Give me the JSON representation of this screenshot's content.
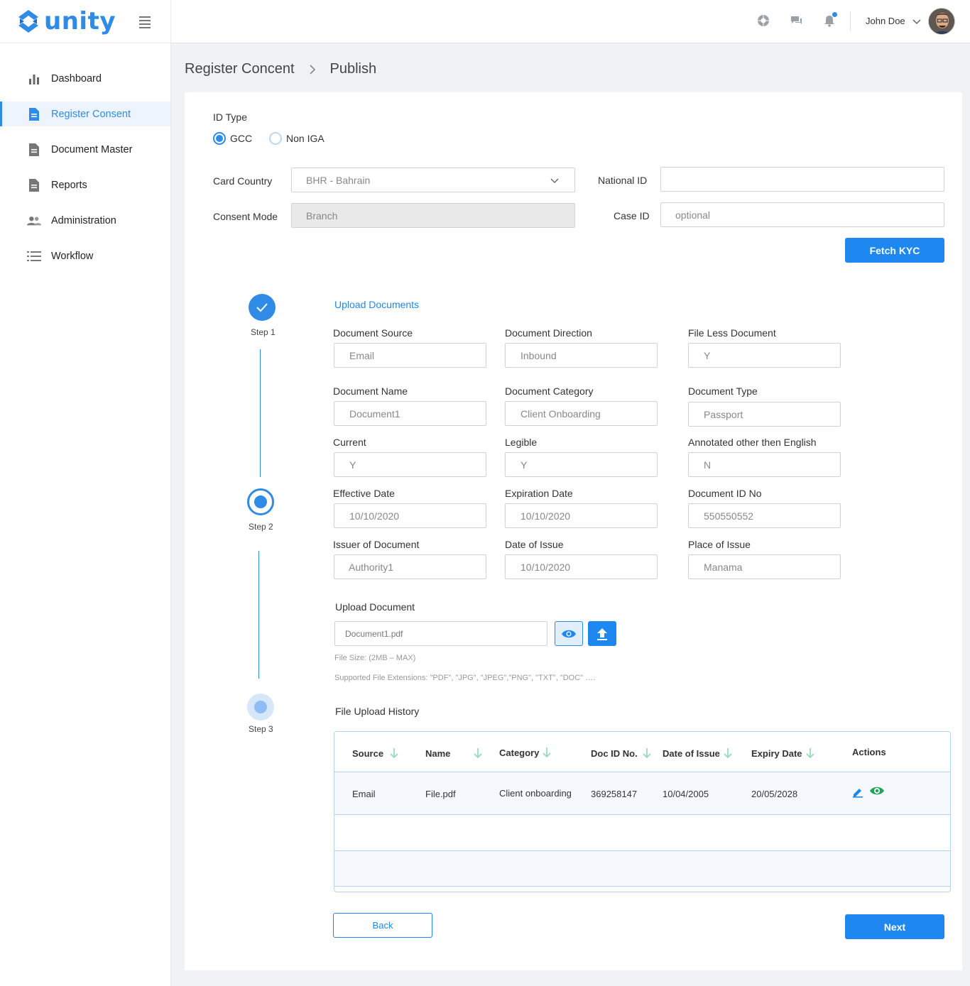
{
  "app": {
    "logo_text": "unity",
    "brand_color": "#2f8be6"
  },
  "sidebar": {
    "items": [
      {
        "label": "Dashboard",
        "icon": "bar-chart-icon"
      },
      {
        "label": "Register Consent",
        "icon": "document-icon",
        "active": true
      },
      {
        "label": "Document Master",
        "icon": "document-icon"
      },
      {
        "label": "Reports",
        "icon": "document-icon"
      },
      {
        "label": "Administration",
        "icon": "users-icon"
      },
      {
        "label": "Workflow",
        "icon": "list-icon"
      }
    ]
  },
  "header": {
    "icons": [
      "support-icon",
      "chat-icon",
      "bell-icon"
    ],
    "user_name": "John Doe"
  },
  "breadcrumb": {
    "items": [
      "Register Concent",
      "Publish"
    ]
  },
  "form": {
    "id_type_label": "ID Type",
    "id_type_options": [
      "GCC",
      "Non IGA"
    ],
    "id_type_selected": "GCC",
    "card_country_label": "Card Country",
    "card_country_value": "BHR - Bahrain",
    "national_id_label": "National ID",
    "national_id_value": "",
    "consent_mode_label": "Consent Mode",
    "consent_mode_value": "Branch",
    "case_id_label": "Case ID",
    "case_id_placeholder": "optional",
    "fetch_button": "Fetch KYC"
  },
  "stepper": {
    "steps": [
      {
        "label": "Step 1",
        "state": "complete"
      },
      {
        "label": "Step 2",
        "state": "current"
      },
      {
        "label": "Step 3",
        "state": "pending"
      }
    ]
  },
  "upload": {
    "section_title": "Upload Documents",
    "fields": [
      {
        "label": "Document Source",
        "value": "Email"
      },
      {
        "label": "Document Direction",
        "value": "Inbound"
      },
      {
        "label": "File Less Document",
        "value": "Y"
      },
      {
        "label": "Document Name",
        "value": "Document1"
      },
      {
        "label": "Document Category",
        "value": "Client Onboarding"
      },
      {
        "label": "Document Type",
        "value": "Passport"
      },
      {
        "label": "Current",
        "value": "Y"
      },
      {
        "label": "Legible",
        "value": "Y"
      },
      {
        "label": "Annotated other then English",
        "value": "N"
      },
      {
        "label": "Effective Date",
        "value": "10/10/2020"
      },
      {
        "label": "Expiration Date",
        "value": "10/10/2020"
      },
      {
        "label": "Document ID No",
        "value": "550550552"
      },
      {
        "label": "Issuer of Document",
        "value": "Authority1"
      },
      {
        "label": "Date of Issue",
        "value": "10/10/2020"
      },
      {
        "label": "Place of Issue",
        "value": "Manama"
      }
    ],
    "upload_document_label": "Upload Document",
    "upload_file_name": "Document1.pdf",
    "file_size_hint": "File Size: (2MB – MAX)",
    "extensions_hint": "Supported File Extensions: \"PDF\", \"JPG\", \"JPEG\",\"PNG\", \"TXT\", \"DOC\" ….",
    "history_title": "File Upload History"
  },
  "history_table": {
    "columns": [
      "Source",
      "Name",
      "Category",
      "Doc ID No.",
      "Date of Issue",
      "Expiry Date",
      "Actions"
    ],
    "rows": [
      {
        "source": "Email",
        "name": "File.pdf",
        "category": "Client onboarding",
        "doc_id": "369258147",
        "date_of_issue": "10/04/2005",
        "expiry_date": "20/05/2028",
        "actions": [
          "edit-icon",
          "view-icon"
        ]
      }
    ]
  },
  "footer": {
    "back_button": "Back",
    "next_button": "Next"
  }
}
